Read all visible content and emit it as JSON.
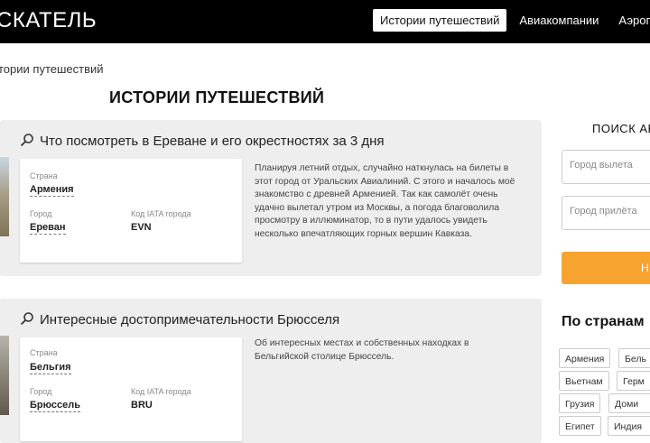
{
  "header": {
    "logo": "СКАТЕЛЬ",
    "nav": [
      {
        "label": "Истории путешествий"
      },
      {
        "label": "Авиакомпании"
      },
      {
        "label": "Аэроп"
      }
    ]
  },
  "breadcrumb": "тории путешествий",
  "page_title": "ИСТОРИИ ПУТЕШЕСТВИЙ",
  "stories": [
    {
      "title": "Что посмотреть в Ереване и его окрестностях за 3 дня",
      "country_label": "Страна",
      "country": "Армения",
      "city_label": "Город",
      "city": "Ереван",
      "iata_label": "Код IATA города",
      "iata": "EVN",
      "text": "Планируя летний отдых, случайно наткнулась на билеты в этот город от Уральских Авиалиний. С этого и началось моё знакомство с древней Арменией. Так как самолёт очень удачно вылетал утром из Москвы, а погода благоволила просмотру в иллюминатор, то в пути удалось увидеть несколько впечатляющих горных вершин Кавказа."
    },
    {
      "title": "Интересные достопримечательности Брюсселя",
      "country_label": "Страна",
      "country": "Бельгия",
      "city_label": "Город",
      "city": "Брюссель",
      "iata_label": "Код IATA города",
      "iata": "BRU",
      "text": "Об интересных местах и собственных находках в Бельгийской столице Брюссель."
    }
  ],
  "sidebar": {
    "search_title": "ПОИСК АВ",
    "from_placeholder": "Город вылета",
    "to_placeholder": "Город прилёта",
    "button_label": "Н",
    "countries_title": "По странам",
    "countries": [
      "Армения",
      "Бель",
      "Вьетнам",
      "Герм",
      "Грузия",
      "Доми",
      "Египет",
      "Индия"
    ]
  },
  "colors": {
    "topbar": "#000000",
    "accent": "#f7a330",
    "card_bg": "#eeeeee"
  }
}
